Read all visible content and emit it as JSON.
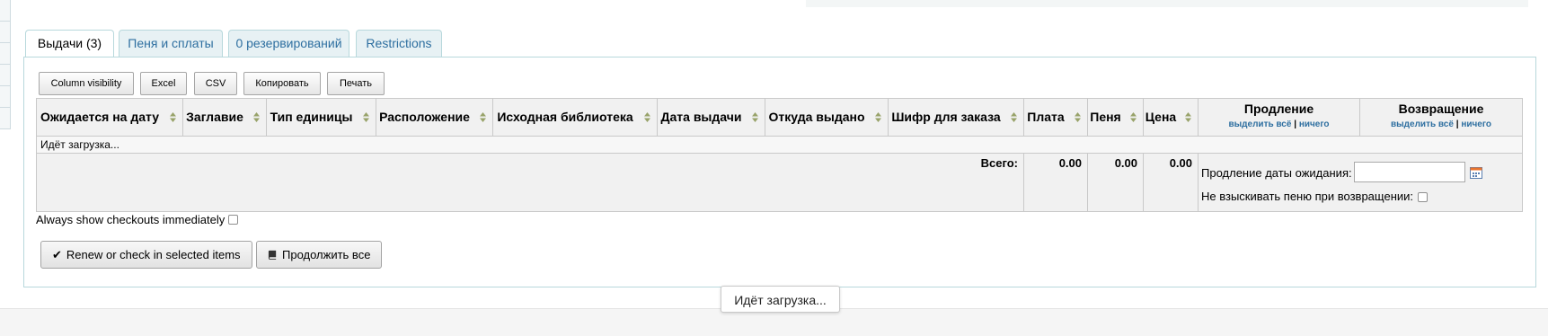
{
  "tabs": [
    {
      "label": "Выдачи (3)",
      "active": true
    },
    {
      "label": "Пеня и сплаты",
      "active": false
    },
    {
      "label": "0 резервирований",
      "active": false
    },
    {
      "label": "Restrictions",
      "active": false
    }
  ],
  "toolbar": {
    "column_visibility": "Column visibility",
    "excel": "Excel",
    "csv": "CSV",
    "copy": "Копировать",
    "print": "Печать"
  },
  "table": {
    "headers": [
      "Ожидается на дату",
      "Заглавие",
      "Тип единицы",
      "Расположение",
      "Исходная библиотека",
      "Дата выдачи",
      "Откуда выдано",
      "Шифр для заказа",
      "Плата",
      "Пеня",
      "Цена"
    ],
    "renew_header": "Продление",
    "return_header": "Возвращение",
    "select_all": "выделить всё",
    "separator": "|",
    "none": "ничего",
    "loading": "Идёт загрузка...",
    "total_label": "Всего:",
    "totals": [
      "0.00",
      "0.00",
      "0.00"
    ]
  },
  "renew_options": {
    "due_date_label": "Продление даты ожидания:",
    "due_date_value": "",
    "no_fine_label": "Не взыскивать пеню при возвращении:"
  },
  "always_show_label": "Always show checkouts immediately",
  "actions": {
    "renew_checkin": "Renew or check in selected items",
    "renew_all": "Продолжить все"
  },
  "toast": "Идёт загрузка...",
  "colors": {
    "tab_border": "#b8d8dc",
    "tab_bg": "#e7f1f4",
    "link": "#2e6fa0",
    "header_bg": "#f1f1f1"
  }
}
